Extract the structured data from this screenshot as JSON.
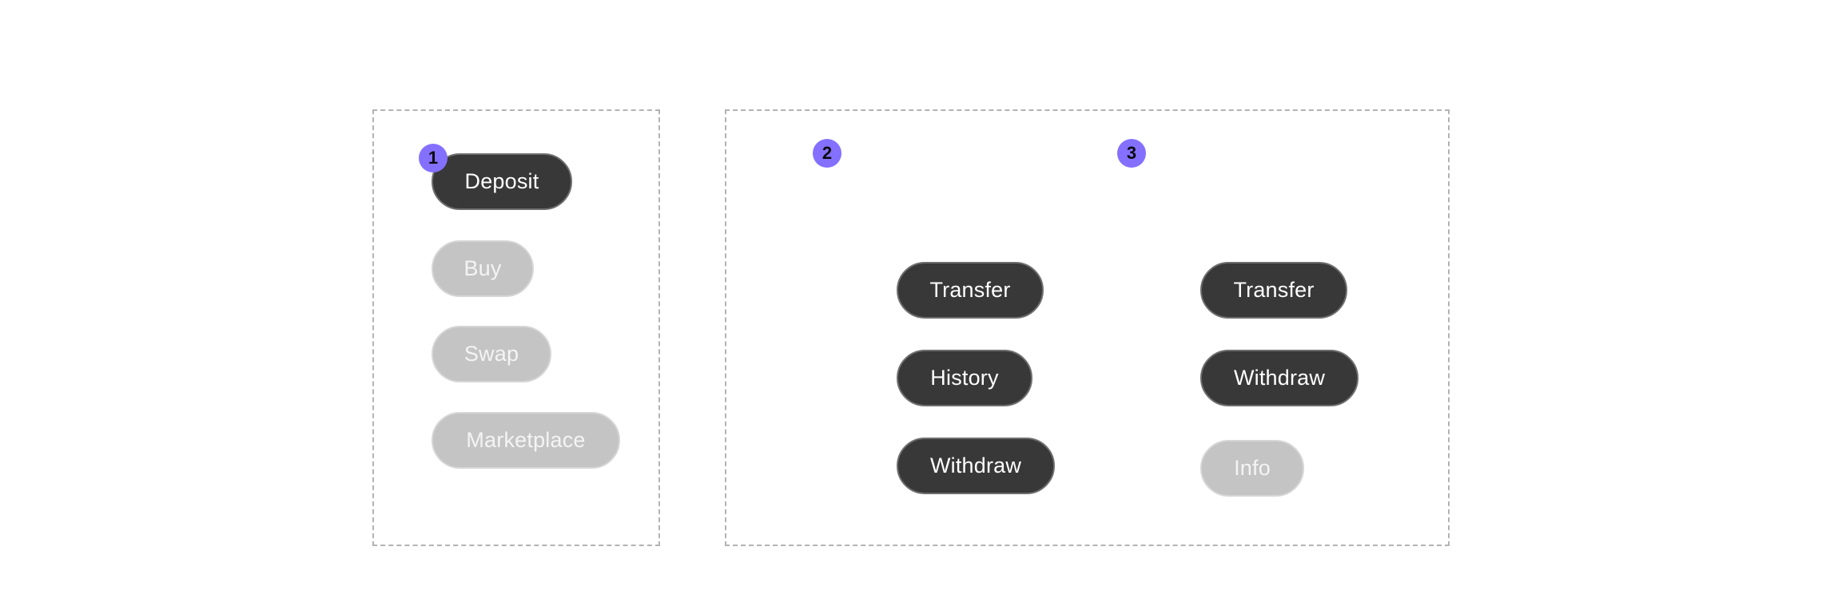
{
  "colors": {
    "badge": "#8470ff",
    "active_button": "#383838",
    "disabled_button": "#c4c4c4",
    "dashed_border": "#b3b3b3"
  },
  "groups": [
    {
      "badge": "1",
      "buttons": [
        {
          "label": "Deposit",
          "state": "active"
        },
        {
          "label": "Buy",
          "state": "disabled"
        },
        {
          "label": "Swap",
          "state": "disabled"
        },
        {
          "label": "Marketplace",
          "state": "disabled"
        }
      ]
    },
    {
      "badge": "2",
      "buttons": [
        {
          "label": "Transfer",
          "state": "active"
        },
        {
          "label": "History",
          "state": "active"
        },
        {
          "label": "Withdraw",
          "state": "active"
        }
      ]
    },
    {
      "badge": "3",
      "buttons": [
        {
          "label": "Transfer",
          "state": "active"
        },
        {
          "label": "Withdraw",
          "state": "active"
        },
        {
          "label": "Info",
          "state": "disabled"
        }
      ]
    }
  ]
}
